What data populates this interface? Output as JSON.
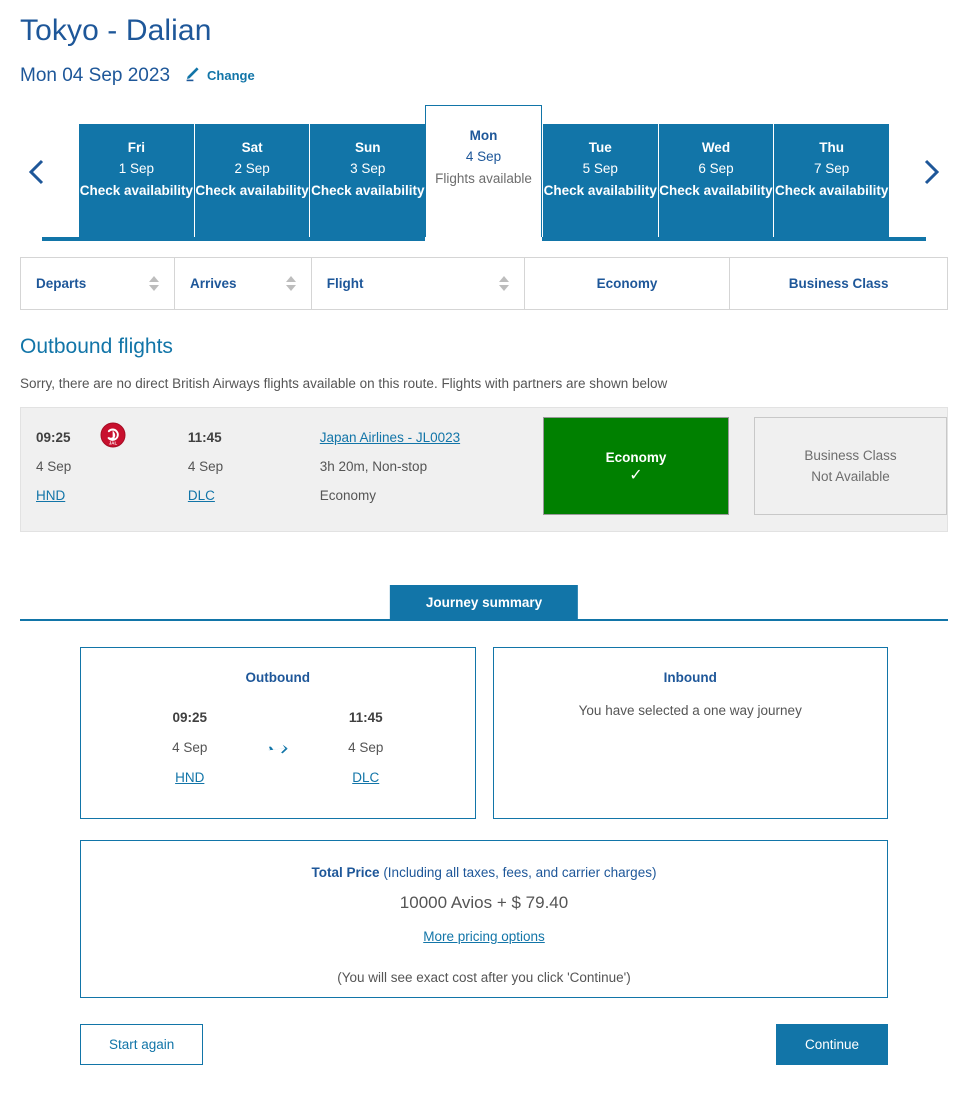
{
  "header": {
    "route_title": "Tokyo - Dalian",
    "flight_date": "Mon 04 Sep 2023",
    "change_label": "Change",
    "pencil_icon": "pencil-icon"
  },
  "date_strip": {
    "prev_icon": "chevron-left-icon",
    "next_icon": "chevron-right-icon",
    "tabs": [
      {
        "dow": "Fri",
        "date": "1 Sep",
        "status": "Check availability",
        "selected": false
      },
      {
        "dow": "Sat",
        "date": "2 Sep",
        "status": "Check availability",
        "selected": false
      },
      {
        "dow": "Sun",
        "date": "3 Sep",
        "status": "Check availability",
        "selected": false
      },
      {
        "dow": "Mon",
        "date": "4 Sep",
        "status": "Flights available",
        "selected": true
      },
      {
        "dow": "Tue",
        "date": "5 Sep",
        "status": "Check availability",
        "selected": false
      },
      {
        "dow": "Wed",
        "date": "6 Sep",
        "status": "Check availability",
        "selected": false
      },
      {
        "dow": "Thu",
        "date": "7 Sep",
        "status": "Check availability",
        "selected": false
      }
    ]
  },
  "columns": {
    "departs": "Departs",
    "arrives": "Arrives",
    "flight": "Flight",
    "economy": "Economy",
    "business": "Business Class",
    "sort_icon": "sort-arrows-icon"
  },
  "outbound": {
    "title": "Outbound flights",
    "note": "Sorry, there are no direct British Airways flights available on this route. Flights with partners are shown below",
    "flights": [
      {
        "depart_time": "09:25",
        "depart_date": "4 Sep",
        "depart_airport": "HND",
        "airline_logo": "japan-airlines-logo",
        "arrive_time": "11:45",
        "arrive_date": "4 Sep",
        "arrive_airport": "DLC",
        "flight_link": "Japan Airlines - JL0023",
        "duration": "3h 20m, Non-stop",
        "cabin": "Economy",
        "economy_label": "Economy",
        "economy_state": "selected",
        "check_icon": "check-icon",
        "business_label": "Business Class",
        "business_state": "Not Available"
      }
    ]
  },
  "summary": {
    "tab_label": "Journey summary",
    "outbound": {
      "title": "Outbound",
      "depart_time": "09:25",
      "depart_date": "4 Sep",
      "depart_airport": "HND",
      "plane_icon": "airplane-icon",
      "arrive_time": "11:45",
      "arrive_date": "4 Sep",
      "arrive_airport": "DLC"
    },
    "inbound": {
      "title": "Inbound",
      "note": "You have selected a one way journey"
    },
    "price": {
      "label": "Total Price",
      "label_suffix": " (Including all taxes, fees, and carrier charges)",
      "amount": "10000 Avios + $ 79.40",
      "more_options": "More pricing options",
      "footnote": "(You will see exact cost after you click 'Continue')"
    }
  },
  "footer": {
    "start_again": "Start again",
    "continue": "Continue"
  },
  "colors": {
    "brand_blue": "#1275a8",
    "dark_blue": "#1e5799",
    "selected_green": "#008000",
    "row_grey": "#f0f0f0"
  }
}
